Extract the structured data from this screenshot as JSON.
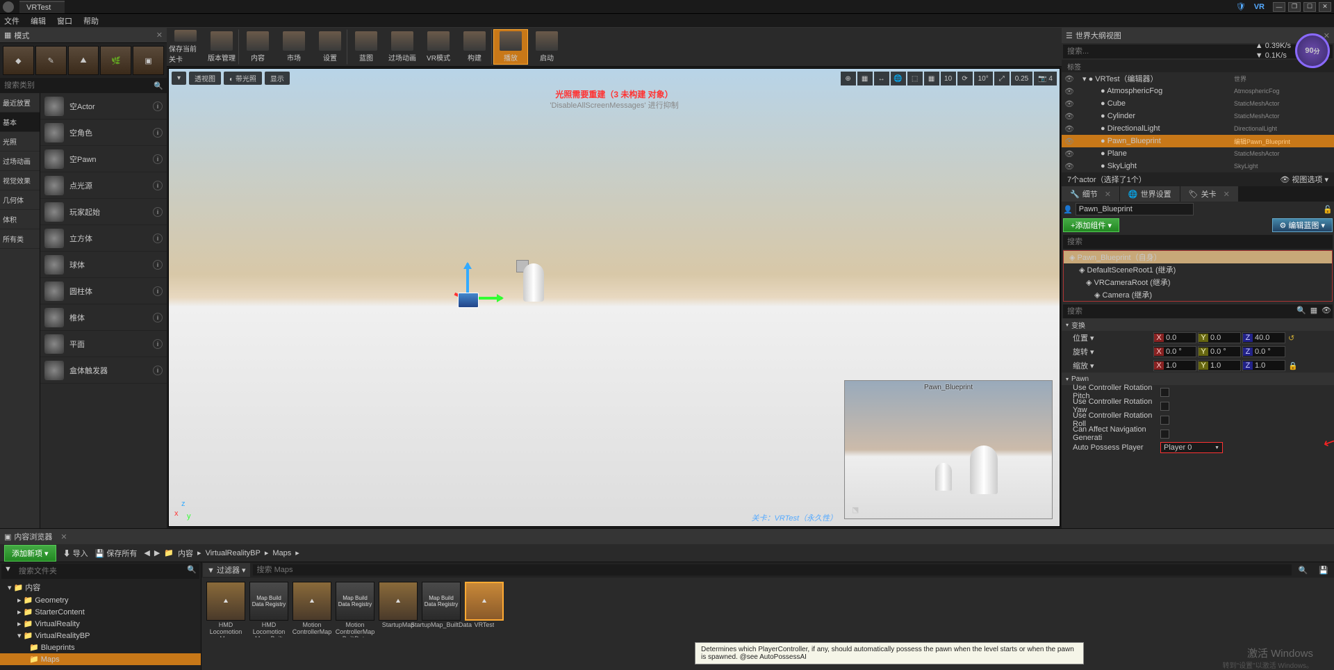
{
  "title_tab": "VRTest",
  "vr_badge": "VR",
  "menus": [
    "文件",
    "编辑",
    "窗口",
    "帮助"
  ],
  "modes_panel": {
    "title": "模式",
    "search_placeholder": "搜索类别"
  },
  "categories": [
    "最近放置",
    "基本",
    "光照",
    "过场动画",
    "视觉效果",
    "几何体",
    "体积",
    "所有类"
  ],
  "actors": [
    "空Actor",
    "空角色",
    "空Pawn",
    "点光源",
    "玩家起始",
    "立方体",
    "球体",
    "圆柱体",
    "椎体",
    "平面",
    "盒体触发器"
  ],
  "toolbar": [
    {
      "label": "保存当前关卡"
    },
    {
      "label": "版本管理"
    },
    {
      "label": "内容"
    },
    {
      "label": "市场"
    },
    {
      "label": "设置"
    },
    {
      "label": "蓝图"
    },
    {
      "label": "过场动画"
    },
    {
      "label": "VR模式"
    },
    {
      "label": "构建"
    },
    {
      "label": "播放",
      "active": true
    },
    {
      "label": "启动"
    }
  ],
  "viewport": {
    "chips": [
      "▾",
      "透视图",
      "◐ 带光照",
      "显示"
    ],
    "right_btns": [
      "⊕",
      "▦",
      "↔",
      "🌐",
      "⬚",
      "▦",
      "10",
      "⟳",
      "10°",
      "⤢",
      "0.25",
      "📷 4"
    ],
    "msg1": "光照需要重建（3 未构建 对象）",
    "msg2": "'DisableAllScreenMessages' 进行抑制",
    "pip_title": "Pawn_Blueprint",
    "footer": "关卡：VRTest（永久性）"
  },
  "outliner": {
    "title": "世界大纲视图",
    "search_placeholder": "搜索...",
    "label_header": "标签",
    "rows": [
      {
        "name": "VRTest（编辑器）",
        "type": "世界",
        "indent": 8,
        "tri": true
      },
      {
        "name": "AtmosphericFog",
        "type": "AtmosphericFog",
        "indent": 34
      },
      {
        "name": "Cube",
        "type": "StaticMeshActor",
        "indent": 34
      },
      {
        "name": "Cylinder",
        "type": "StaticMeshActor",
        "indent": 34
      },
      {
        "name": "DirectionalLight",
        "type": "DirectionalLight",
        "indent": 34
      },
      {
        "name": "Pawn_Blueprint",
        "type": "",
        "indent": 34,
        "sel": true,
        "edit": "编辑Pawn_Blueprint"
      },
      {
        "name": "Plane",
        "type": "StaticMeshActor",
        "indent": 34
      },
      {
        "name": "SkyLight",
        "type": "SkyLight",
        "indent": 34
      }
    ],
    "footer_left": "7个actor（选择了1个）",
    "footer_right": "👁 视图选项 ▾"
  },
  "fps": {
    "circle": "90",
    "sub": "分",
    "l1": "0.39K/s",
    "l2": "0.1K/s"
  },
  "details": {
    "tabs": [
      "细节",
      "世界设置",
      "关卡"
    ],
    "name": "Pawn_Blueprint",
    "btn_add": "+添加组件 ▾",
    "btn_edit": "⚙ 编辑蓝图 ▾",
    "search_placeholder": "搜索",
    "components": [
      {
        "label": "Pawn_Blueprint（自身）",
        "indent": 4,
        "sel": true
      },
      {
        "label": "DefaultSceneRoot1 (继承)",
        "indent": 18
      },
      {
        "label": "VRCameraRoot (继承)",
        "indent": 28
      },
      {
        "label": "Camera (继承)",
        "indent": 40
      }
    ],
    "det_search_placeholder": "搜索",
    "sec_transform": "变换",
    "loc": "位置 ▾",
    "rot": "旋转 ▾",
    "scl": "缩放 ▾",
    "loc_vals": [
      "0.0",
      "0.0",
      "40.0"
    ],
    "rot_vals": [
      "0.0 °",
      "0.0 °",
      "0.0 °"
    ],
    "scl_vals": [
      "1.0",
      "1.0",
      "1.0"
    ],
    "sec_pawn": "Pawn",
    "pawn_props": [
      "Use Controller Rotation Pitch",
      "Use Controller Rotation Yaw",
      "Use Controller Rotation Roll",
      "Can Affect Navigation Generati"
    ],
    "auto_possess_label": "Auto Possess Player",
    "auto_possess_value": "Player 0"
  },
  "content_browser": {
    "tab": "内容浏览器",
    "btn_add": "添加新项 ▾",
    "btn_import": "⬇ 导入",
    "btn_save": "💾 保存所有",
    "crumbs": [
      "内容",
      "VirtualRealityBP",
      "Maps"
    ],
    "tree_search_placeholder": "搜索文件夹",
    "tree": [
      {
        "label": "内容",
        "indent": 4,
        "tri": "▾"
      },
      {
        "label": "Geometry",
        "indent": 18,
        "tri": "▸"
      },
      {
        "label": "StarterContent",
        "indent": 18,
        "tri": "▸"
      },
      {
        "label": "VirtualReality",
        "indent": 18,
        "tri": "▸"
      },
      {
        "label": "VirtualRealityBP",
        "indent": 18,
        "tri": "▾"
      },
      {
        "label": "Blueprints",
        "indent": 32,
        "tri": ""
      },
      {
        "label": "Maps",
        "indent": 32,
        "tri": "",
        "sel": true
      }
    ],
    "filter_label": "过滤器 ▾",
    "asset_search_placeholder": "搜索 Maps",
    "assets": [
      {
        "name": "HMD Locomotion Map",
        "thumb": ""
      },
      {
        "name": "HMD Locomotion Map_Built",
        "thumb": "Map Build Data Registry",
        "dark": true
      },
      {
        "name": "Motion ControllerMap",
        "thumb": ""
      },
      {
        "name": "Motion ControllerMap BuiltData",
        "thumb": "Map Build Data Registry",
        "dark": true
      },
      {
        "name": "StartupMap",
        "thumb": ""
      },
      {
        "name": "StartupMap_BuiltData",
        "thumb": "Map Build Data Registry",
        "dark": true
      },
      {
        "name": "VRTest",
        "thumb": "",
        "sel": true
      }
    ]
  },
  "tooltip": "Determines which PlayerController, if any, should automatically possess the pawn when the level starts or when the pawn is spawned. @see AutoPossessAI",
  "watermark": "激活 Windows",
  "watermark2": "转到\"设置\"以激活 Windows。"
}
